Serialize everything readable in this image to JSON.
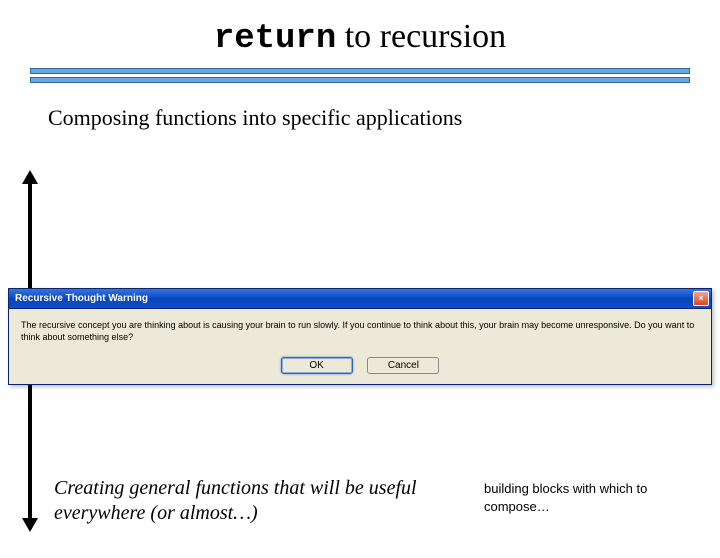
{
  "title": {
    "keyword": "return",
    "rest": " to  recursion"
  },
  "subtitle": "Composing functions into specific applications",
  "dialog": {
    "title": "Recursive Thought Warning",
    "message": "The recursive concept you are thinking about is causing your brain to run slowly. If you continue to think about this, your brain may become unresponsive. Do you want to think about something else?",
    "ok": "OK",
    "cancel": "Cancel",
    "close": "×"
  },
  "footer": {
    "main": "Creating general functions that will be useful everywhere (or almost…)",
    "note": "building blocks with which to compose…"
  }
}
